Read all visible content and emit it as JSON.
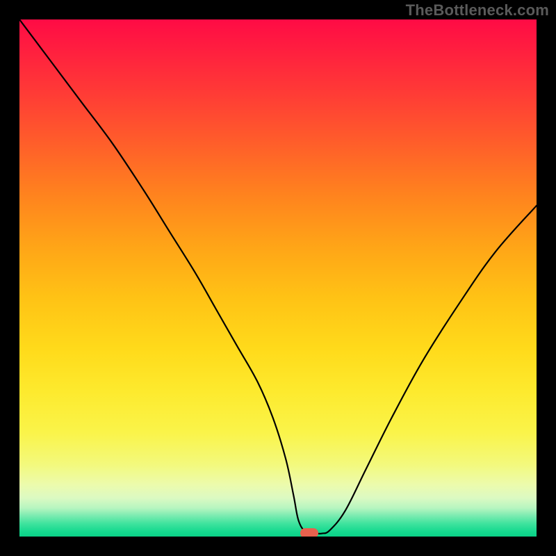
{
  "watermark": "TheBottleneck.com",
  "colors": {
    "frame": "#000000",
    "curve": "#000000",
    "marker": "#e8614e"
  },
  "chart_data": {
    "type": "line",
    "title": "",
    "xlabel": "",
    "ylabel": "",
    "xlim": [
      0,
      100
    ],
    "ylim": [
      0,
      100
    ],
    "grid": false,
    "legend": false,
    "series": [
      {
        "name": "bottleneck-curve",
        "x": [
          0,
          6,
          12,
          18,
          24,
          29,
          34,
          38,
          42,
          46,
          49,
          51.5,
          53,
          54,
          55.5,
          57.5,
          58.5,
          60,
          63,
          67,
          72,
          78,
          85,
          92,
          100
        ],
        "y": [
          100,
          92,
          84,
          76,
          67,
          59,
          51,
          44,
          37,
          30,
          23,
          15,
          8,
          3,
          0.8,
          0.6,
          0.6,
          1.2,
          5,
          13,
          23,
          34,
          45,
          55,
          64
        ]
      }
    ],
    "flat_segment": {
      "x_start": 54,
      "x_end": 58.5,
      "y": 0.7
    },
    "marker": {
      "x": 56,
      "y": 0.7
    },
    "background": {
      "type": "vertical-gradient",
      "stops": [
        {
          "pos": 0,
          "color": "#ff0b45"
        },
        {
          "pos": 24,
          "color": "#ff5e2a"
        },
        {
          "pos": 54,
          "color": "#ffc315"
        },
        {
          "pos": 80,
          "color": "#faf44a"
        },
        {
          "pos": 93,
          "color": "#dcfac2"
        },
        {
          "pos": 100,
          "color": "#0ad187"
        }
      ]
    }
  }
}
